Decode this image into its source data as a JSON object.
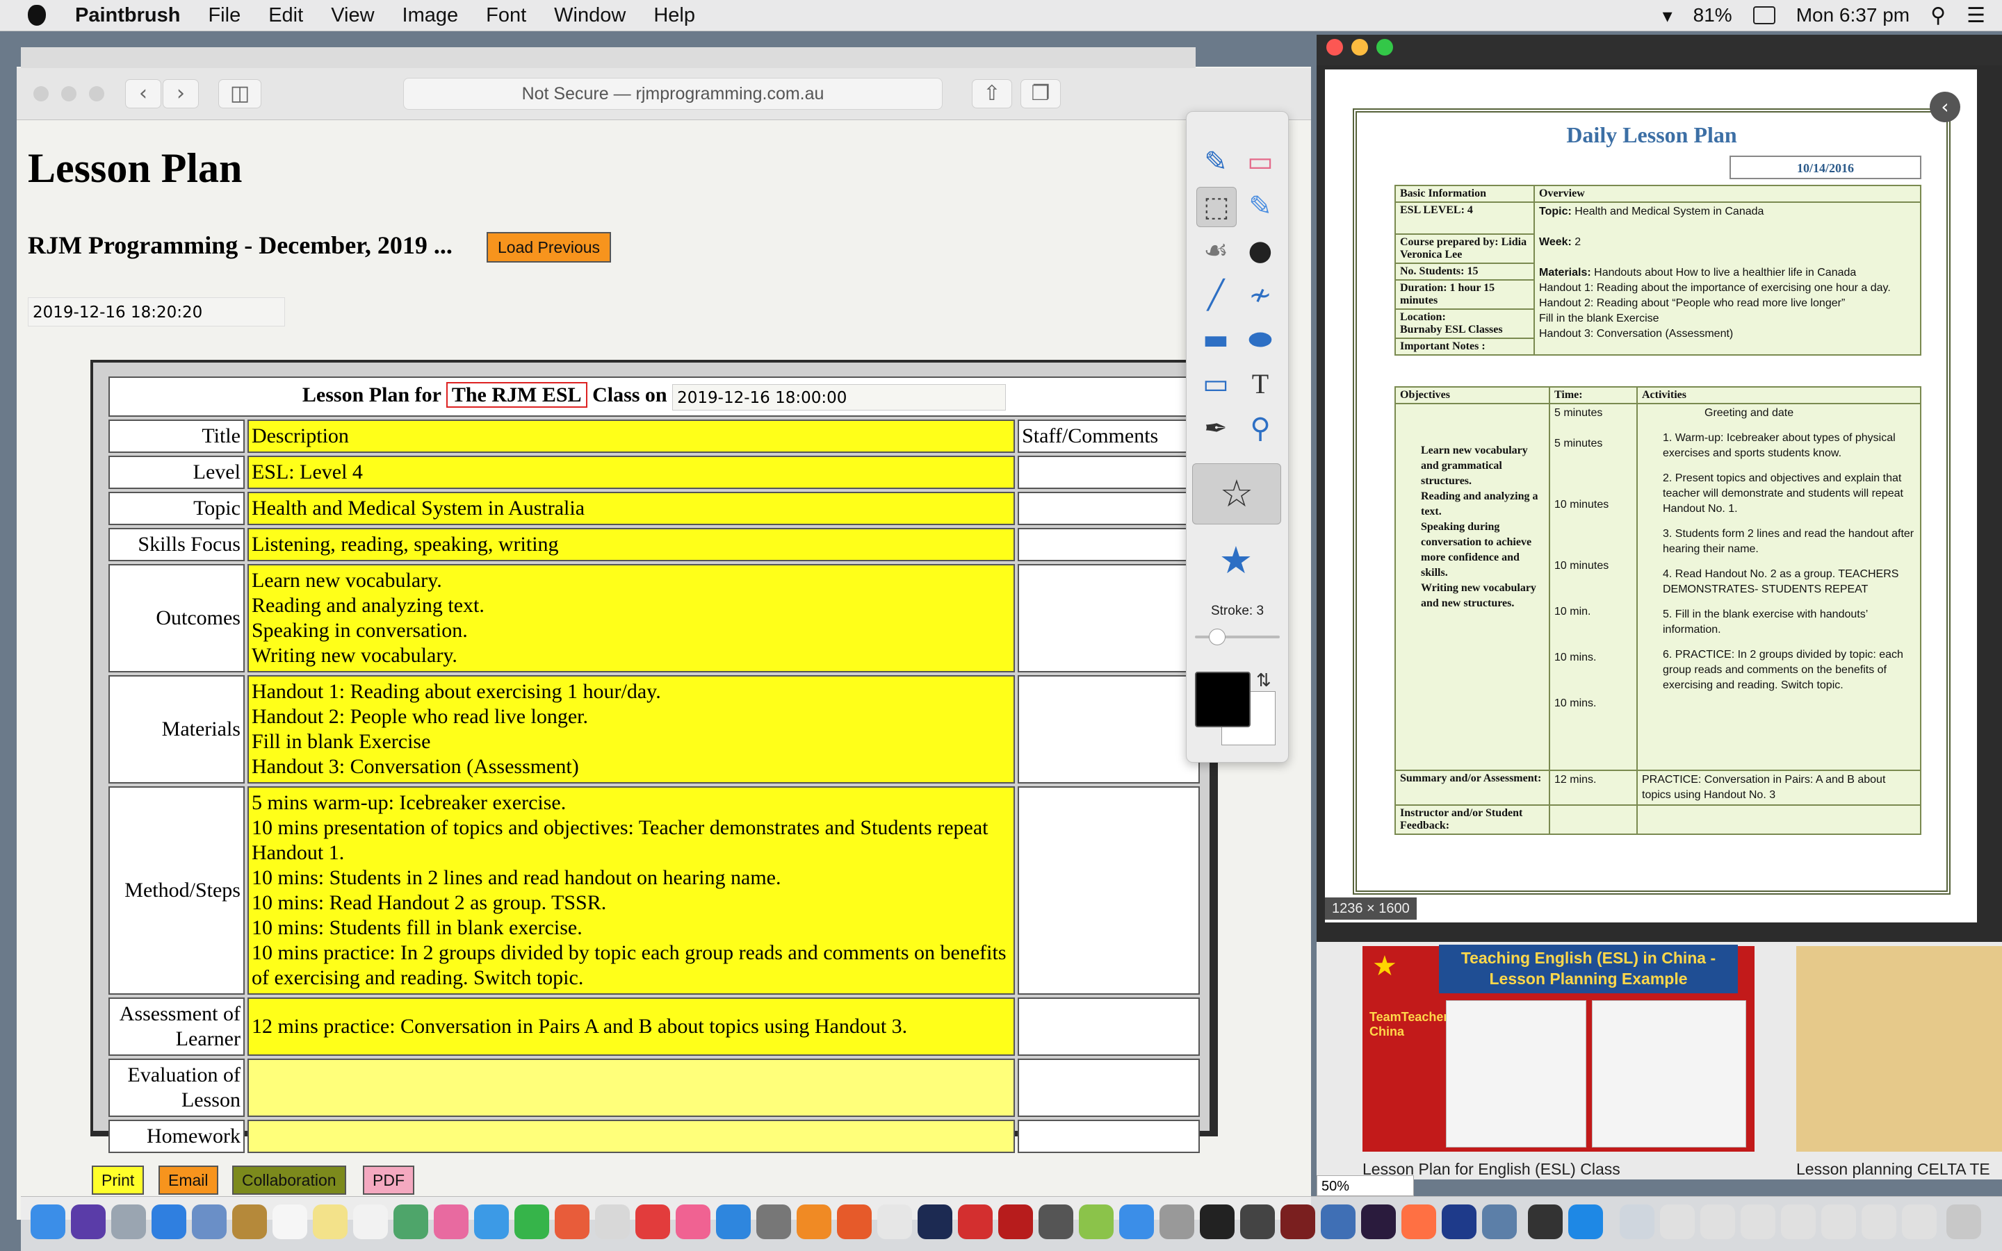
{
  "menubar": {
    "app": "Paintbrush",
    "menus": [
      "File",
      "Edit",
      "View",
      "Image",
      "Font",
      "Window",
      "Help"
    ],
    "battery": "81%",
    "clock": "Mon 6:37 pm"
  },
  "browser": {
    "address": "Not Secure — rjmprogramming.com.au",
    "page_title": "Lesson Plan",
    "subtitle": "RJM Programming - December, 2019 ...",
    "load_previous": "Load Previous",
    "timestamp": "2019-12-16 18:20:20",
    "caption_prefix": "Lesson Plan for",
    "caption_school": "The RJM ESL",
    "caption_mid": "Class on",
    "caption_date": "2019-12-16 18:00:00",
    "header": {
      "title": "Title",
      "description": "Description",
      "staff": "Staff/Comments"
    },
    "rows": [
      {
        "label": "Level",
        "lines": [
          "ESL: Level  4"
        ]
      },
      {
        "label": "Topic",
        "lines": [
          "Health and Medical System in Australia"
        ]
      },
      {
        "label": "Skills Focus",
        "lines": [
          "Listening, reading, speaking, writing"
        ]
      },
      {
        "label": "Outcomes",
        "lines": [
          "Learn new vocabulary.",
          "Reading and analyzing text.",
          "Speaking in conversation.",
          "Writing new vocabulary."
        ]
      },
      {
        "label": "Materials",
        "lines": [
          "Handout 1: Reading about exercising 1 hour/day.",
          "Handout 2: People who read live longer.",
          "Fill in blank Exercise",
          "Handout 3: Conversation (Assessment)"
        ]
      },
      {
        "label": "Method/Steps",
        "lines": [
          "5 mins warm-up: Icebreaker exercise.",
          "10 mins presentation of topics and objectives: Teacher demonstrates and Students repeat Handout 1.",
          "10 mins: Students in 2 lines and read handout on hearing name.",
          "10 mins: Read Handout 2 as group.  TSSR.",
          "10 mins: Students fill in blank exercise.",
          "10 mins practice: In 2 groups divided by topic each group reads and comments on benefits of exercising and reading. Switch topic."
        ]
      },
      {
        "label": "Assessment of Learner",
        "lines": [
          "12 mins practice: Conversation in Pairs A and B about topics using Handout 3."
        ]
      },
      {
        "label": "Evaluation of Lesson",
        "lines": [
          ""
        ]
      },
      {
        "label": "Homework",
        "lines": [
          ""
        ]
      }
    ],
    "buttons": {
      "print": "Print",
      "email": "Email",
      "collaboration": "Collaboration",
      "pdf": "PDF"
    }
  },
  "palette": {
    "stroke_label": "Stroke: 3",
    "stroke_value": 3,
    "tools": [
      "paintbrush-icon",
      "eraser-icon",
      "selection-icon",
      "fill-icon",
      "bucket-icon",
      "bomb-icon",
      "line-icon",
      "curve-icon",
      "rectangle-icon",
      "ellipse-icon",
      "rounded-rect-icon",
      "text-icon",
      "eyedropper-icon",
      "zoom-icon"
    ],
    "foreground": "#000000",
    "background": "#ffffff"
  },
  "preview": {
    "doc_title": "Daily Lesson Plan",
    "doc_date": "10/14/2016",
    "basic_info": "Basic Information",
    "overview": "Overview",
    "level": "ESL     LEVEL:  4",
    "topic_label": "Topic:",
    "topic": "Health and Medical System in Canada",
    "course_by": "Course prepared by: Lidia Veronica Lee",
    "week_label": "Week:",
    "week": "2",
    "students": "No. Students: 15",
    "duration": "Duration: 1 hour 15 minutes",
    "location": "Location:",
    "location_val": "Burnaby ESL Classes",
    "important": "Important Notes :",
    "materials_label": "Materials:",
    "materials": "Handouts about How to live a healthier life in Canada",
    "handout1": "Handout 1: Reading about the importance of exercising one hour a day.",
    "handout2": "Handout 2: Reading about “People who read more live longer”",
    "blank": "Fill in the blank Exercise",
    "handout3": "Handout 3: Conversation (Assessment)",
    "col_objectives": "Objectives",
    "col_time": "Time:",
    "col_activities": "Activities",
    "objectives": [
      "Learn new vocabulary and grammatical structures.",
      "Reading and analyzing a text.",
      "Speaking during conversation to achieve more confidence and skills.",
      "Writing new vocabulary and new structures."
    ],
    "times": [
      "5 minutes",
      "5 minutes",
      "10 minutes",
      "10 minutes",
      "10 min.",
      "10 mins.",
      "10 mins."
    ],
    "activities": [
      "Greeting and date",
      "1. Warm-up: Icebreaker about types of physical exercises and sports students know.",
      "2. Present topics and objectives and explain that teacher will demonstrate and students will repeat Handout No. 1.",
      "3. Students form 2 lines and read the handout after hearing their name.",
      "4. Read Handout No. 2 as a group. TEACHERS DEMONSTRATES- STUDENTS REPEAT",
      "5. Fill in the blank exercise with handouts’ information.",
      "6. PRACTICE: In 2 groups divided by topic:  each group reads and comments on the benefits of exercising and reading. Switch topic."
    ],
    "summary_label": "Summary and/or Assessment:",
    "summary_time": "12 mins.",
    "summary": "PRACTICE: Conversation in Pairs: A and B about topics using Handout No. 3",
    "instructor": "Instructor and/or Student Feedback:",
    "dimensions": "1236 × 1600"
  },
  "grid": {
    "thumb1_title": "Teaching English (ESL) in China - Lesson Planning Example",
    "thumb1_logo": "TeamTeacher China",
    "caption1": "Lesson Plan for English (ESL) Class",
    "caption2": "Lesson planning CELTA TE",
    "zoom": "50%"
  }
}
